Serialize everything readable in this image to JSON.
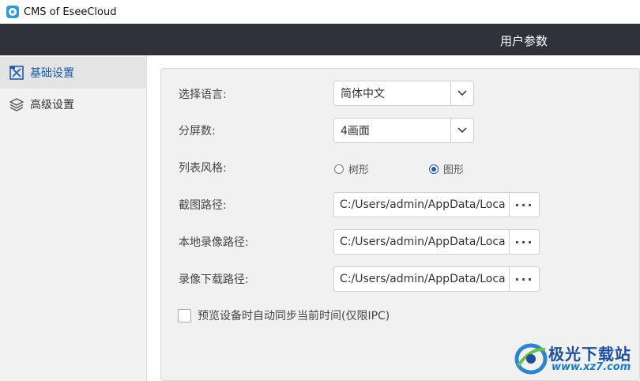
{
  "window": {
    "title": "CMS of EseeCloud"
  },
  "header": {
    "title": "用户参数"
  },
  "sidebar": {
    "items": [
      {
        "label": "基础设置",
        "icon": "basic-settings-icon",
        "active": true
      },
      {
        "label": "高级设置",
        "icon": "layers-icon",
        "active": false
      }
    ]
  },
  "settings": {
    "language": {
      "label": "选择语言:",
      "value": "简体中文"
    },
    "split_screen": {
      "label": "分屏数:",
      "value": "4画面"
    },
    "list_style": {
      "label": "列表风格:",
      "options": [
        "树形",
        "图形"
      ],
      "selected": "图形"
    },
    "snapshot_path": {
      "label": "截图路径:",
      "value": "C:/Users/admin/AppData/Loca",
      "button": "···"
    },
    "local_record_path": {
      "label": "本地录像路径:",
      "value": "C:/Users/admin/AppData/Loca",
      "button": "···"
    },
    "record_download_path": {
      "label": "录像下载路径:",
      "value": "C:/Users/admin/AppData/Loca",
      "button": "···"
    },
    "sync_time": {
      "label": "预览设备时自动同步当前时间(仅限IPC)",
      "checked": false
    }
  },
  "watermark": {
    "line1": "极光下载站",
    "line2": "www.xz7.com"
  },
  "colors": {
    "header_bg": "#2f3238",
    "accent": "#1e5aa8",
    "sidebar_bg": "#f2f2f2",
    "panel_bg": "#f1f1f1"
  }
}
